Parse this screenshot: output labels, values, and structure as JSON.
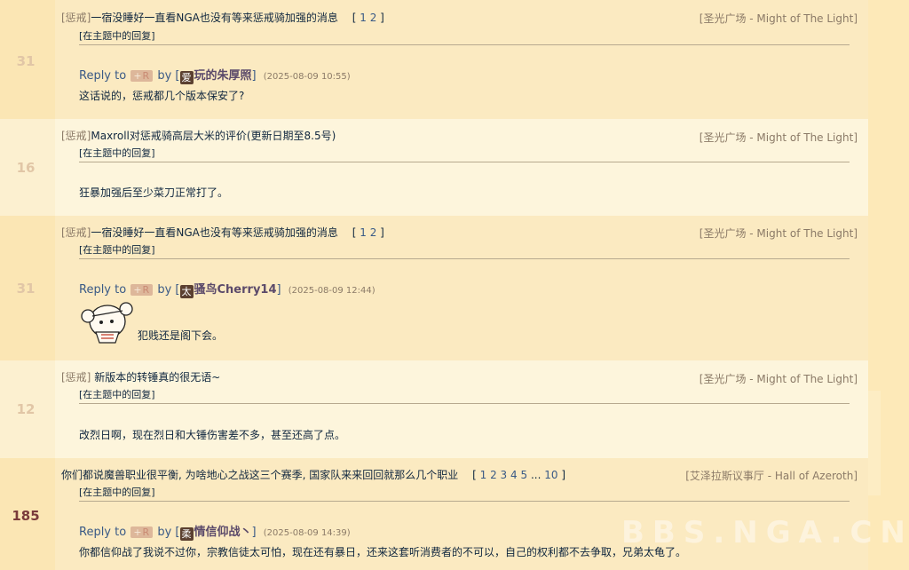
{
  "threads": [
    {
      "count": "31",
      "tag": "[惩戒]",
      "title": "一宿没睡好一直看NGA也没有等来惩戒骑加强的消息",
      "pages": [
        "1",
        "2"
      ],
      "forum": "[圣光广场 - Might of The Light]",
      "sub": "[在主题中的回复]",
      "reply_prefix": "Reply to",
      "plus_label": "+",
      "plus_r": "R",
      "by_label": "by",
      "badge": "爱",
      "user": "玩的朱厚照",
      "date": "(2025-08-09 10:55)",
      "text": "这话说的，惩戒都几个版本保安了?"
    },
    {
      "count": "16",
      "tag": "[惩戒]",
      "title": "Maxroll对惩戒骑高层大米的评价(更新日期至8.5号)",
      "forum": "[圣光广场 - Might of The Light]",
      "sub": "[在主题中的回复]",
      "text": "狂暴加强后至少菜刀正常打了。"
    },
    {
      "count": "31",
      "tag": "[惩戒]",
      "title": "一宿没睡好一直看NGA也没有等来惩戒骑加强的消息",
      "pages": [
        "1",
        "2"
      ],
      "forum": "[圣光广场 - Might of The Light]",
      "sub": "[在主题中的回复]",
      "reply_prefix": "Reply to",
      "plus_label": "+",
      "plus_r": "R",
      "by_label": "by",
      "badge": "太",
      "user": "骚鸟Cherry14",
      "date": "(2025-08-09 12:44)",
      "text": "犯贱还是阁下会。"
    },
    {
      "count": "12",
      "tag": "[惩戒]",
      "title": " 新版本的转锤真的很无语~",
      "forum": "[圣光广场 - Might of The Light]",
      "sub": "[在主题中的回复]",
      "text": "改烈日啊，现在烈日和大锤伤害差不多，甚至还高了点。"
    },
    {
      "count": "185",
      "title": "你们都说魔兽职业很平衡, 为啥地心之战这三个赛季, 国家队来来回回就那么几个职业",
      "pages": [
        "1",
        "2",
        "3",
        "4",
        "5",
        "...",
        "10"
      ],
      "forum": "[艾泽拉斯议事厅 - Hall of Azeroth]",
      "sub": "[在主题中的回复]",
      "reply_prefix": "Reply to",
      "plus_label": "+",
      "plus_r": "R",
      "by_label": "by",
      "badge": "柔",
      "user": "情信仰战丶",
      "date": "(2025-08-09 14:39)",
      "text": "你都信仰战了我说不过你，宗教信徒太可怕，现在还有暴日，还来这套听消费者的不可以，自己的权利都不去争取，兄弟太龟了。"
    }
  ],
  "watermark": "BBS.NGA.CN",
  "colors": {
    "link": "#3a5a86",
    "tag": "#8b7a67",
    "text": "#10273f",
    "hot": "#7a3b3b"
  }
}
